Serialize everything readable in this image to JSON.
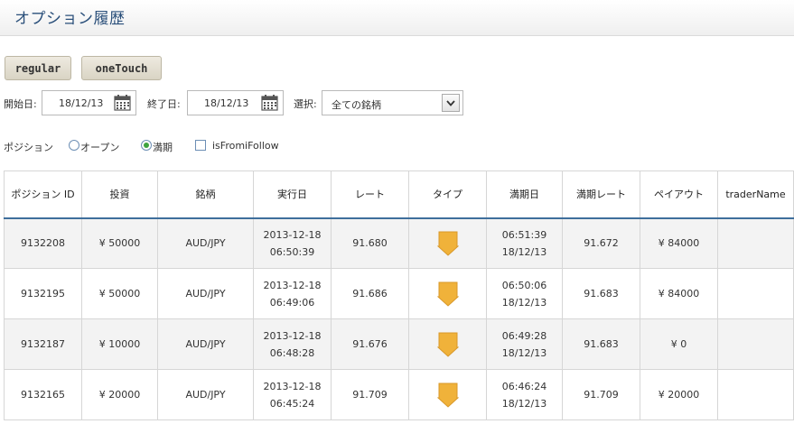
{
  "page": {
    "title": "オプション履歴"
  },
  "tabs": {
    "regular": "regular",
    "onetouch": "oneTouch"
  },
  "filters": {
    "start_label": "開始日:",
    "start_value": "18/12/13",
    "end_label": "終了日:",
    "end_value": "18/12/13",
    "select_label": "選択:",
    "select_value": "全ての銘柄"
  },
  "position": {
    "label": "ポジション",
    "open_label": "オープン",
    "expired_label": "満期",
    "follow_label": "isFromiFollow"
  },
  "table": {
    "headers": [
      "ポジション ID",
      "投資",
      "銘柄",
      "実行日",
      "レート",
      "タイプ",
      "満期日",
      "満期レート",
      "ペイアウト",
      "traderName"
    ],
    "rows": [
      {
        "id": "9132208",
        "invest": "¥ 50000",
        "symbol": "AUD/JPY",
        "exec_date": "2013-12-18",
        "exec_time": "06:50:39",
        "rate": "91.680",
        "type": "down",
        "exp_time": "06:51:39",
        "exp_date": "18/12/13",
        "exp_rate": "91.672",
        "payout": "¥ 84000",
        "trader": ""
      },
      {
        "id": "9132195",
        "invest": "¥ 50000",
        "symbol": "AUD/JPY",
        "exec_date": "2013-12-18",
        "exec_time": "06:49:06",
        "rate": "91.686",
        "type": "down",
        "exp_time": "06:50:06",
        "exp_date": "18/12/13",
        "exp_rate": "91.683",
        "payout": "¥ 84000",
        "trader": ""
      },
      {
        "id": "9132187",
        "invest": "¥ 10000",
        "symbol": "AUD/JPY",
        "exec_date": "2013-12-18",
        "exec_time": "06:48:28",
        "rate": "91.676",
        "type": "down",
        "exp_time": "06:49:28",
        "exp_date": "18/12/13",
        "exp_rate": "91.683",
        "payout": "¥ 0",
        "trader": ""
      },
      {
        "id": "9132165",
        "invest": "¥ 20000",
        "symbol": "AUD/JPY",
        "exec_date": "2013-12-18",
        "exec_time": "06:45:24",
        "rate": "91.709",
        "type": "down",
        "exp_time": "06:46:24",
        "exp_date": "18/12/13",
        "exp_rate": "91.709",
        "payout": "¥ 20000",
        "trader": ""
      }
    ]
  },
  "icons": {
    "date": "calendar-icon",
    "select": "chevron-down-icon",
    "type": "arrow-down-icon"
  },
  "colors": {
    "title": "#2a4f7a",
    "header_rule": "#3e6e9c",
    "arrow": "#f0b23a",
    "radio_checked": "#3ea33e"
  }
}
